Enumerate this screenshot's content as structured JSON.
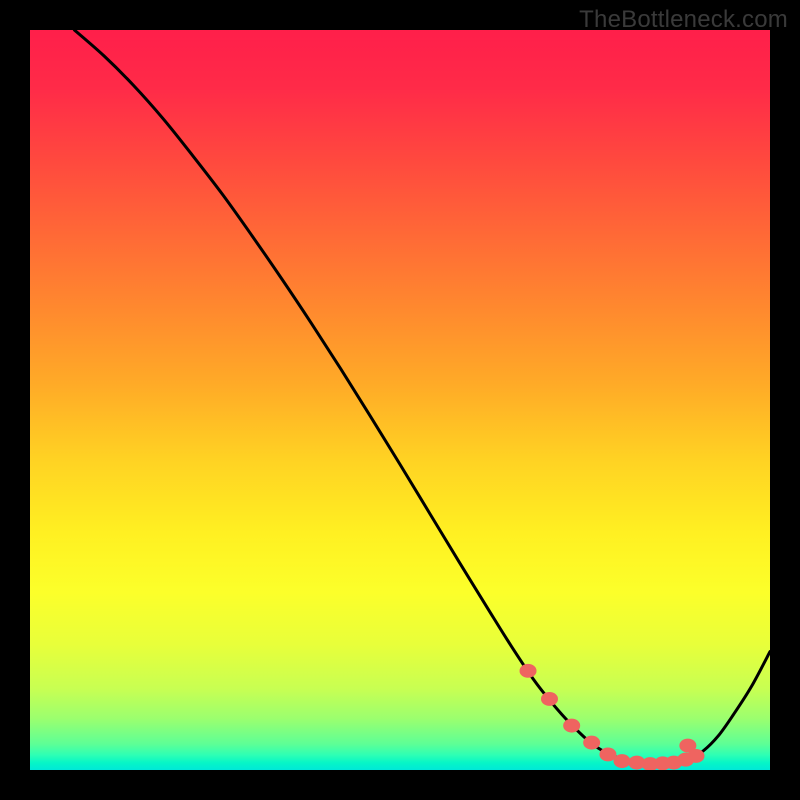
{
  "watermark": "TheBottleneck.com",
  "chart_data": {
    "type": "line",
    "title": "",
    "xlabel": "",
    "ylabel": "",
    "xlim": [
      0,
      100
    ],
    "ylim": [
      0,
      100
    ],
    "grid": false,
    "legend": false,
    "curve": {
      "name": "bottleneck-curve",
      "x": [
        6,
        10,
        14,
        18,
        22,
        26,
        30,
        34,
        38,
        42,
        46,
        50,
        54,
        58,
        62,
        65,
        68,
        70.5,
        73,
        76,
        79,
        82,
        84.5,
        87,
        89,
        91,
        93,
        95,
        97.5,
        100
      ],
      "y": [
        100,
        96.5,
        92.5,
        88,
        83,
        77.8,
        72.2,
        66.4,
        60.4,
        54.2,
        47.8,
        41.3,
        34.7,
        28.1,
        21.6,
        16.8,
        12.3,
        9.1,
        6.3,
        3.5,
        1.8,
        1.0,
        0.8,
        0.9,
        1.4,
        2.6,
        4.6,
        7.4,
        11.3,
        16
      ]
    },
    "markers": {
      "name": "highlight-dots",
      "x": [
        67.3,
        70.2,
        73.2,
        75.9,
        78.1,
        80.0,
        82.0,
        83.8,
        85.5,
        87.0,
        88.6,
        88.9,
        90.0
      ],
      "y": [
        13.4,
        9.6,
        6.0,
        3.7,
        2.1,
        1.2,
        1.0,
        0.8,
        0.9,
        1.0,
        1.4,
        3.3,
        1.9
      ],
      "color": "#ef6460",
      "size": 8.5
    }
  }
}
